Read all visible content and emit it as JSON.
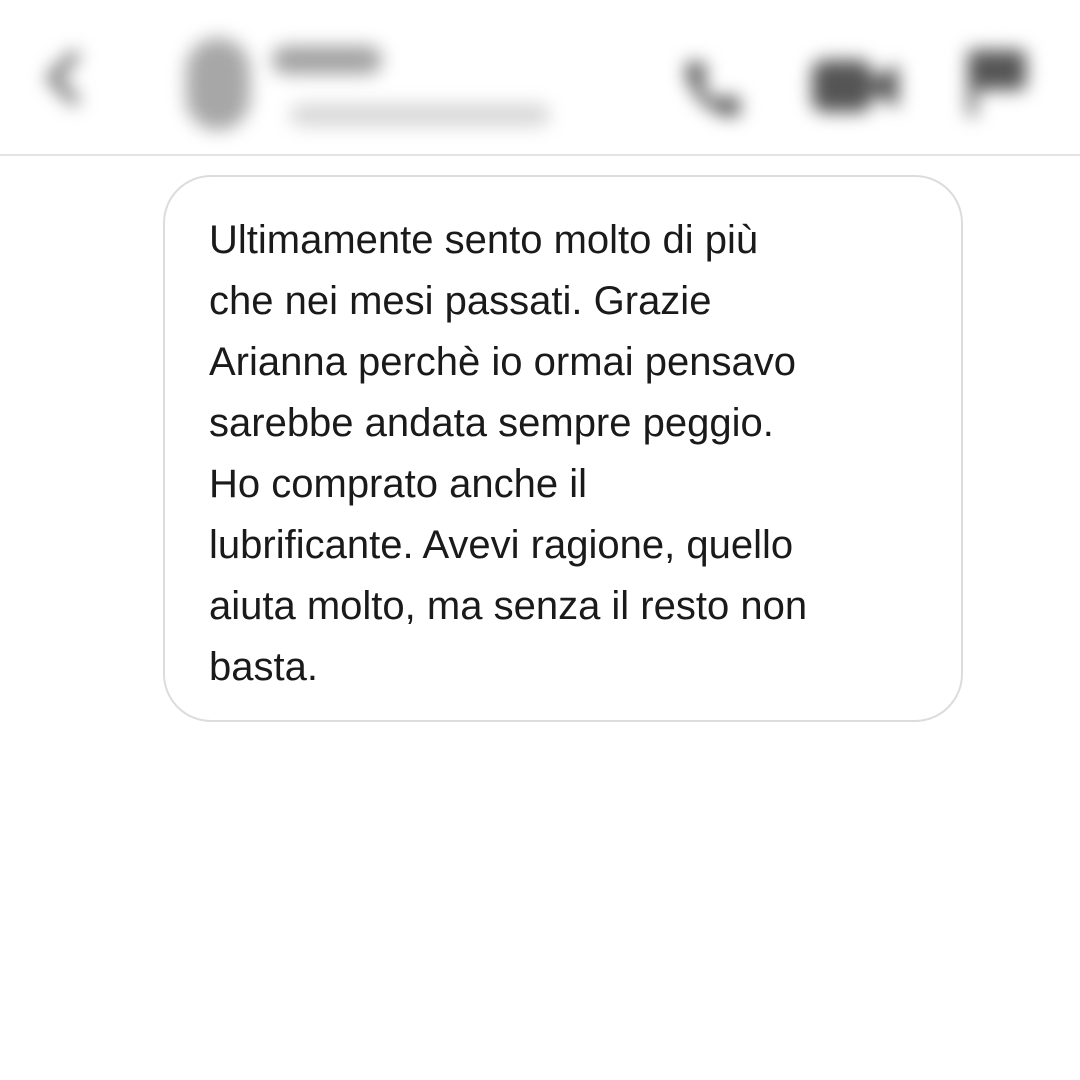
{
  "header": {
    "icons": {
      "back": "chevron-left-icon",
      "avatar": "avatar",
      "call": "phone-icon",
      "video": "video-camera-icon",
      "flag": "flag-icon"
    }
  },
  "message": {
    "text": "Ultimamente sento molto di più\nche nei mesi passati. Grazie\nArianna perchè io ormai pensavo\nsarebbe andata sempre peggio.\nHo comprato anche il\nlubrificante. Avevi ragione, quello\naiuta molto, ma senza il resto non\nbasta."
  },
  "colors": {
    "background": "#ffffff",
    "bubble_border": "#dcdcdc",
    "text": "#1a1a1a",
    "header_divider": "#e4e4e4"
  }
}
